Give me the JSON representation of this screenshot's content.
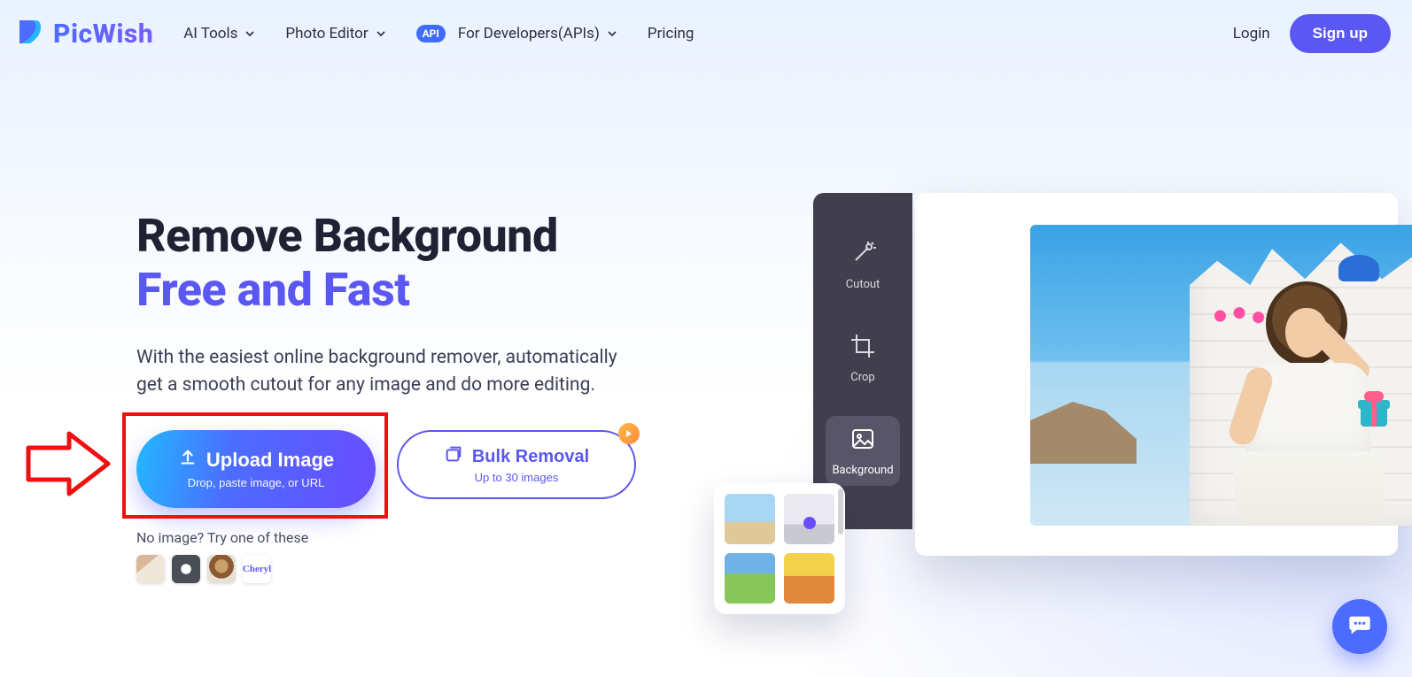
{
  "brand": {
    "name": "PicWish"
  },
  "nav": {
    "items": [
      {
        "label": "AI Tools"
      },
      {
        "label": "Photo Editor"
      },
      {
        "label": "For Developers(APIs)",
        "badge": "API"
      },
      {
        "label": "Pricing"
      }
    ],
    "login": "Login",
    "signup": "Sign up"
  },
  "hero": {
    "title_line1": "Remove Background",
    "title_line2": "Free and Fast",
    "lead": "With the easiest online background remover, automatically get a smooth cutout for any image and do more editing.",
    "upload": {
      "label": "Upload Image",
      "sub": "Drop, paste image, or URL"
    },
    "bulk": {
      "label": "Bulk Removal",
      "sub": "Up to 30 images"
    },
    "noimage": "No image? Try one of these",
    "sample4_text": "Cheryl"
  },
  "tools": {
    "cutout": "Cutout",
    "crop": "Crop",
    "background": "Background"
  }
}
